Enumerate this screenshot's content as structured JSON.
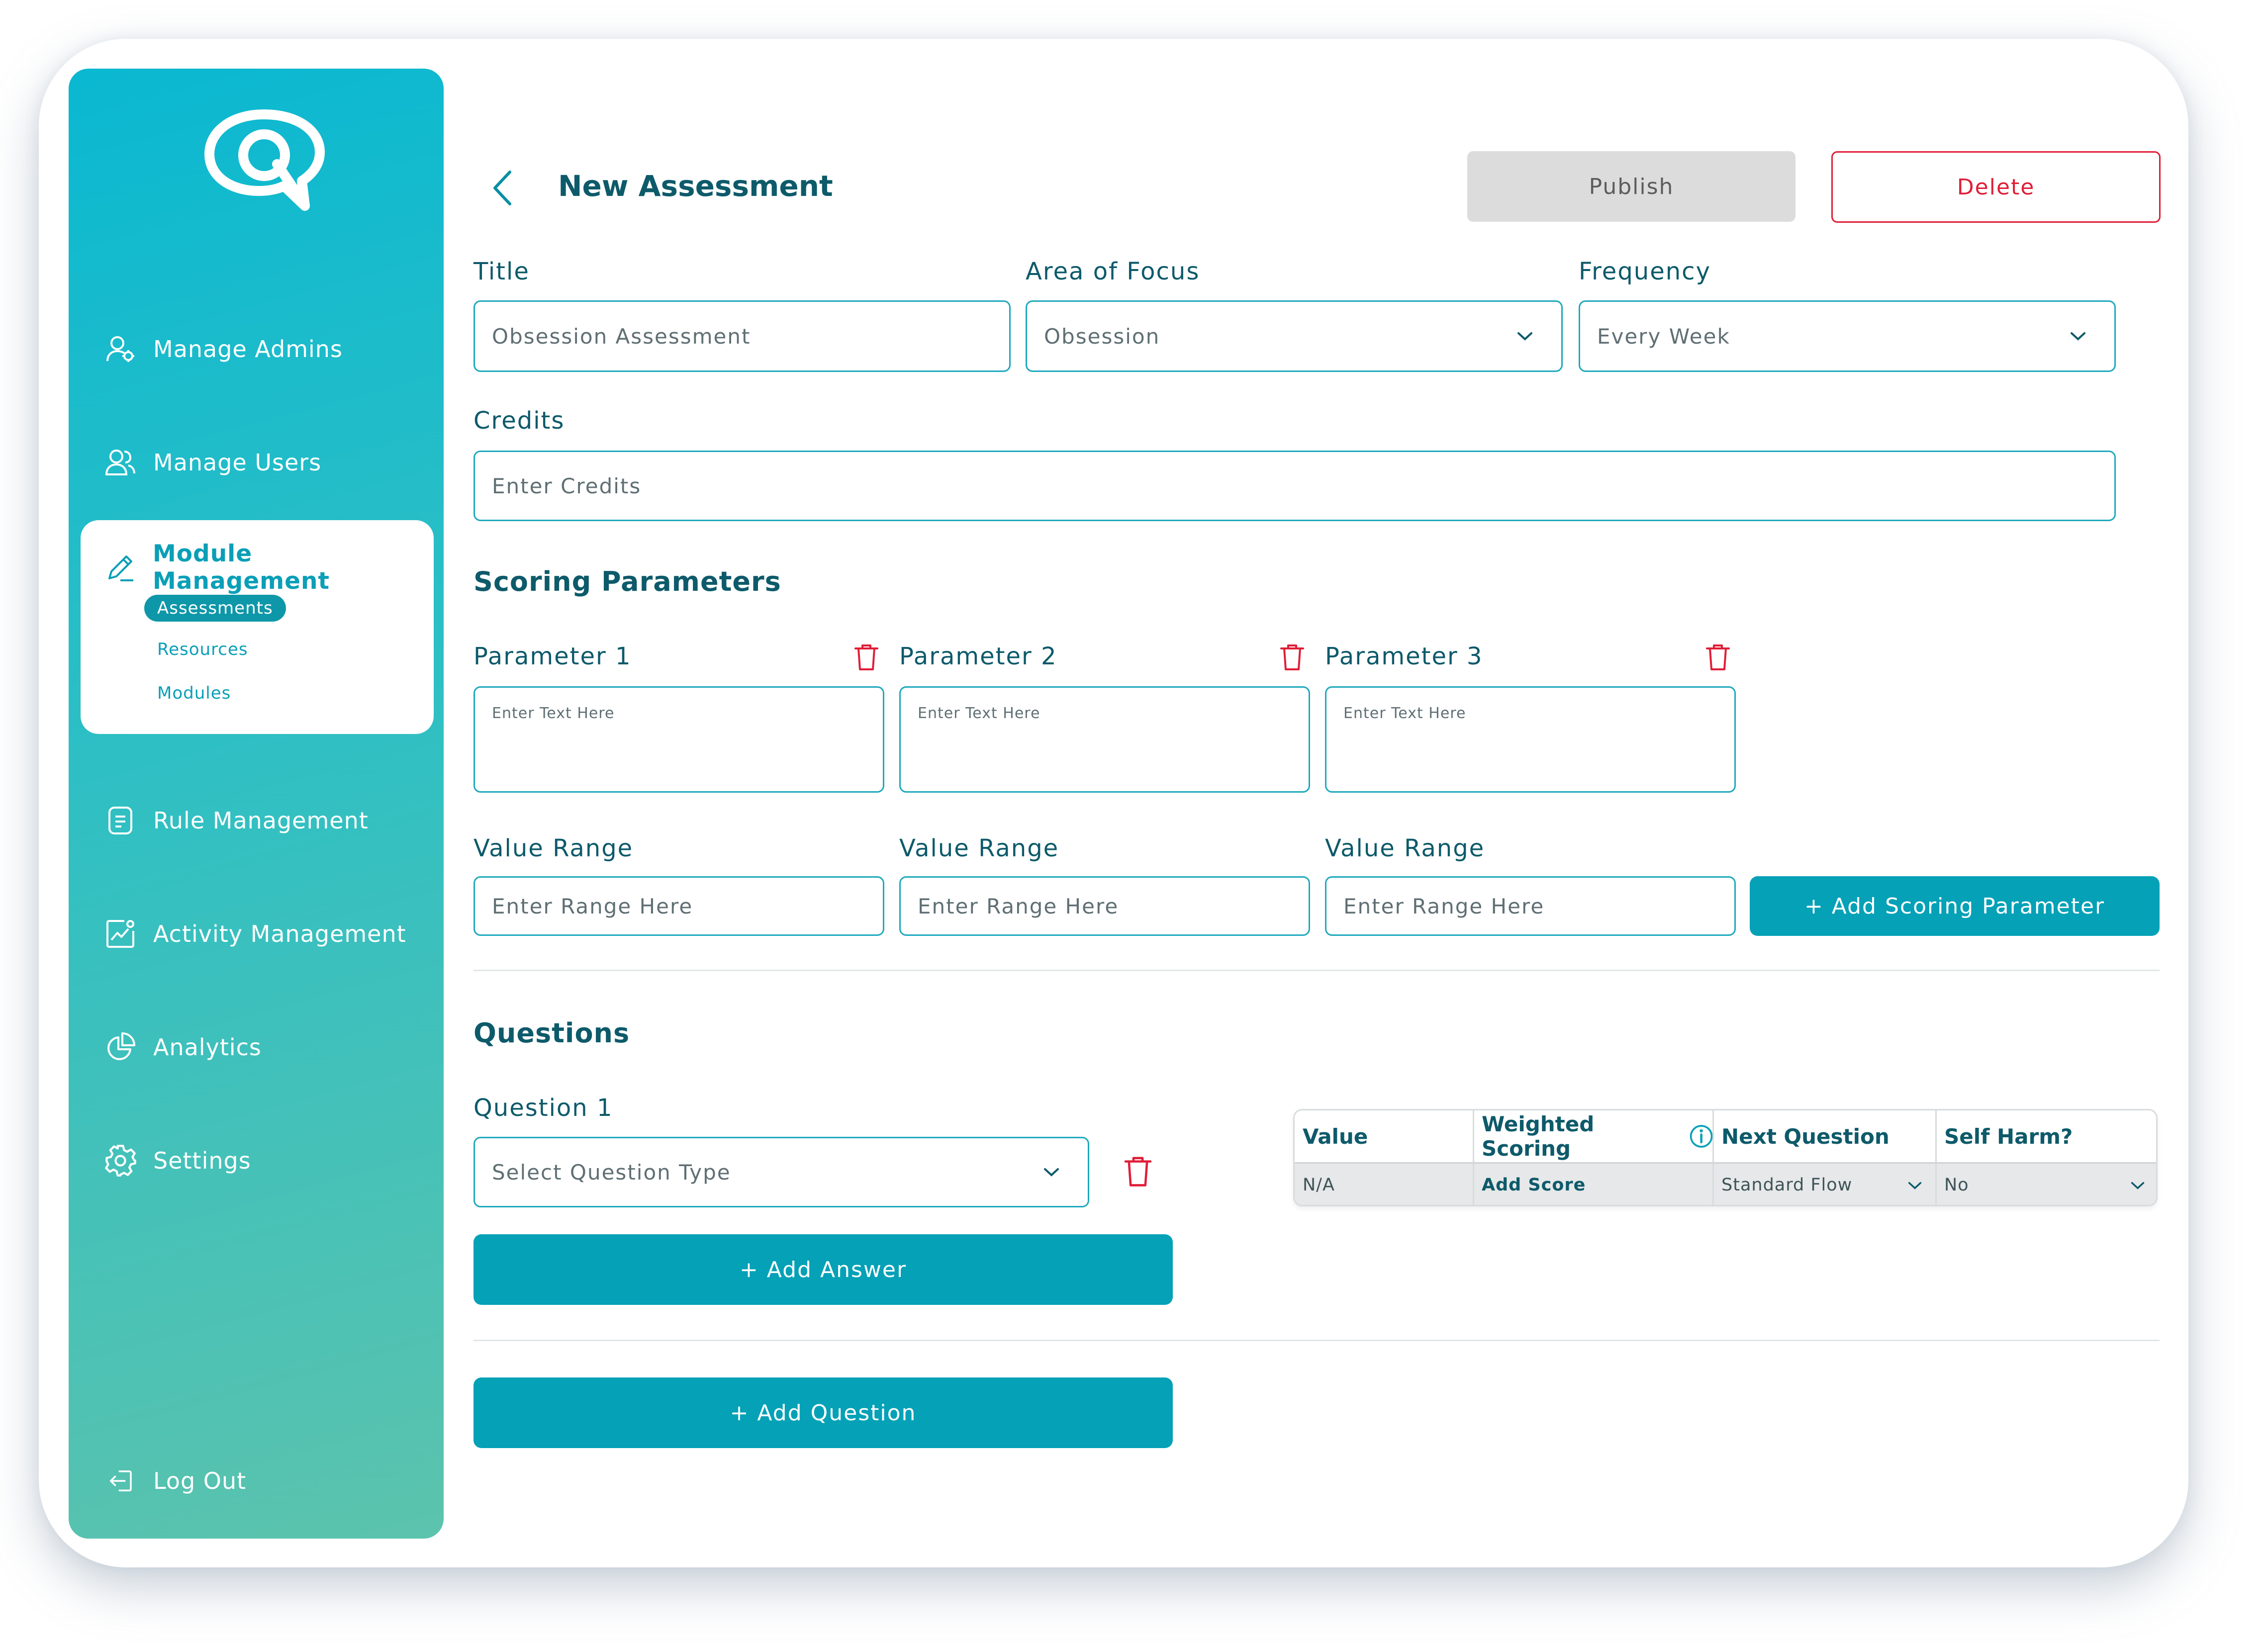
{
  "sidebar": {
    "nav": {
      "manage_admins": "Manage Admins",
      "manage_users": "Manage Users",
      "module_management": "Module Management",
      "rule_management": "Rule Management",
      "activity_management": "Activity Management",
      "analytics": "Analytics",
      "settings": "Settings",
      "log_out": "Log Out"
    },
    "module_sub": {
      "active": "Assessments",
      "resources": "Resources",
      "modules": "Modules"
    }
  },
  "header": {
    "title": "New Assessment",
    "publish_label": "Publish",
    "delete_label": "Delete"
  },
  "form": {
    "title_label": "Title",
    "title_value": "Obsession Assessment",
    "area_label": "Area of Focus",
    "area_value": "Obsession",
    "frequency_label": "Frequency",
    "frequency_value": "Every Week",
    "credits_label": "Credits",
    "credits_placeholder": "Enter Credits"
  },
  "scoring": {
    "heading": "Scoring Parameters",
    "parameters": [
      {
        "label": "Parameter 1",
        "placeholder": "Enter Text Here",
        "range_label": "Value Range",
        "range_placeholder": "Enter Range Here"
      },
      {
        "label": "Parameter 2",
        "placeholder": "Enter Text Here",
        "range_label": "Value Range",
        "range_placeholder": "Enter Range Here"
      },
      {
        "label": "Parameter 3",
        "placeholder": "Enter Text Here",
        "range_label": "Value Range",
        "range_placeholder": "Enter Range Here"
      }
    ],
    "add_label": "+  Add Scoring Parameter"
  },
  "questions": {
    "heading": "Questions",
    "question_label": "Question 1",
    "type_placeholder": "Select Question Type",
    "add_answer_label": "+  Add Answer",
    "add_question_label": "+  Add Question",
    "answer_table": {
      "headers": [
        "Value",
        "Weighted Scoring",
        "Next Question",
        "Self Harm?"
      ],
      "row": {
        "value": "N/A",
        "score": "Add Score",
        "next": "Standard Flow",
        "self_harm": "No"
      }
    }
  },
  "colors": {
    "brand_teal": "#04a1b7",
    "dark_text": "#0d5a6a",
    "danger": "#e01e37",
    "field_border": "#1fa9bd"
  },
  "icons": [
    "logo-icon",
    "admin-icon",
    "users-icon",
    "pencil-icon",
    "rules-icon",
    "activity-icon",
    "analytics-icon",
    "gear-icon",
    "logout-icon",
    "chevron-left-icon",
    "chevron-down-icon",
    "trash-icon",
    "info-icon"
  ]
}
